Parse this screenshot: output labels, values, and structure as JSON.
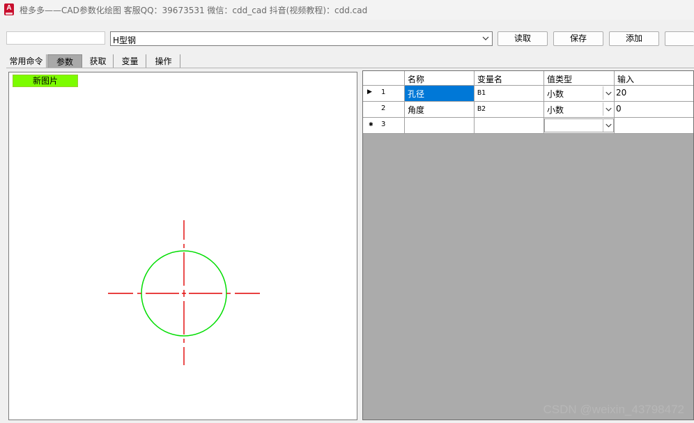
{
  "window": {
    "title": "橙多多——CAD参数化绘图  客服QQ：39673531    微信：cdd_cad    抖音(视频教程)：cdd.cad",
    "icon": "autocad-app-icon"
  },
  "toolbar": {
    "name_input_value": "",
    "combo_value": "H型钢",
    "read_label": "读取",
    "save_label": "保存",
    "add_label": "添加"
  },
  "tabs": [
    {
      "label": "常用命令"
    },
    {
      "label": "参数",
      "active": true
    },
    {
      "label": "获取"
    },
    {
      "label": "变量"
    },
    {
      "label": "操作"
    }
  ],
  "left_panel": {
    "new_picture_label": "新图片",
    "accent": "#7cfc00",
    "drawing": {
      "circle_color": "#00dd00",
      "centerline_color": "#e00000"
    }
  },
  "grid": {
    "headers": [
      "名称",
      "变量名",
      "值类型",
      "输入"
    ],
    "rows": [
      {
        "marker": "▶",
        "index": "1",
        "name": "孔径",
        "var": "B1",
        "type": "小数",
        "input": "20",
        "selected_col": "name"
      },
      {
        "marker": "",
        "index": "2",
        "name": "角度",
        "var": "B2",
        "type": "小数",
        "input": "0"
      },
      {
        "marker": "✱",
        "index": "3",
        "name": "",
        "var": "",
        "type": "",
        "input": ""
      }
    ],
    "selection_color": "#0078d7"
  },
  "watermark": "CSDN @weixin_43798472"
}
